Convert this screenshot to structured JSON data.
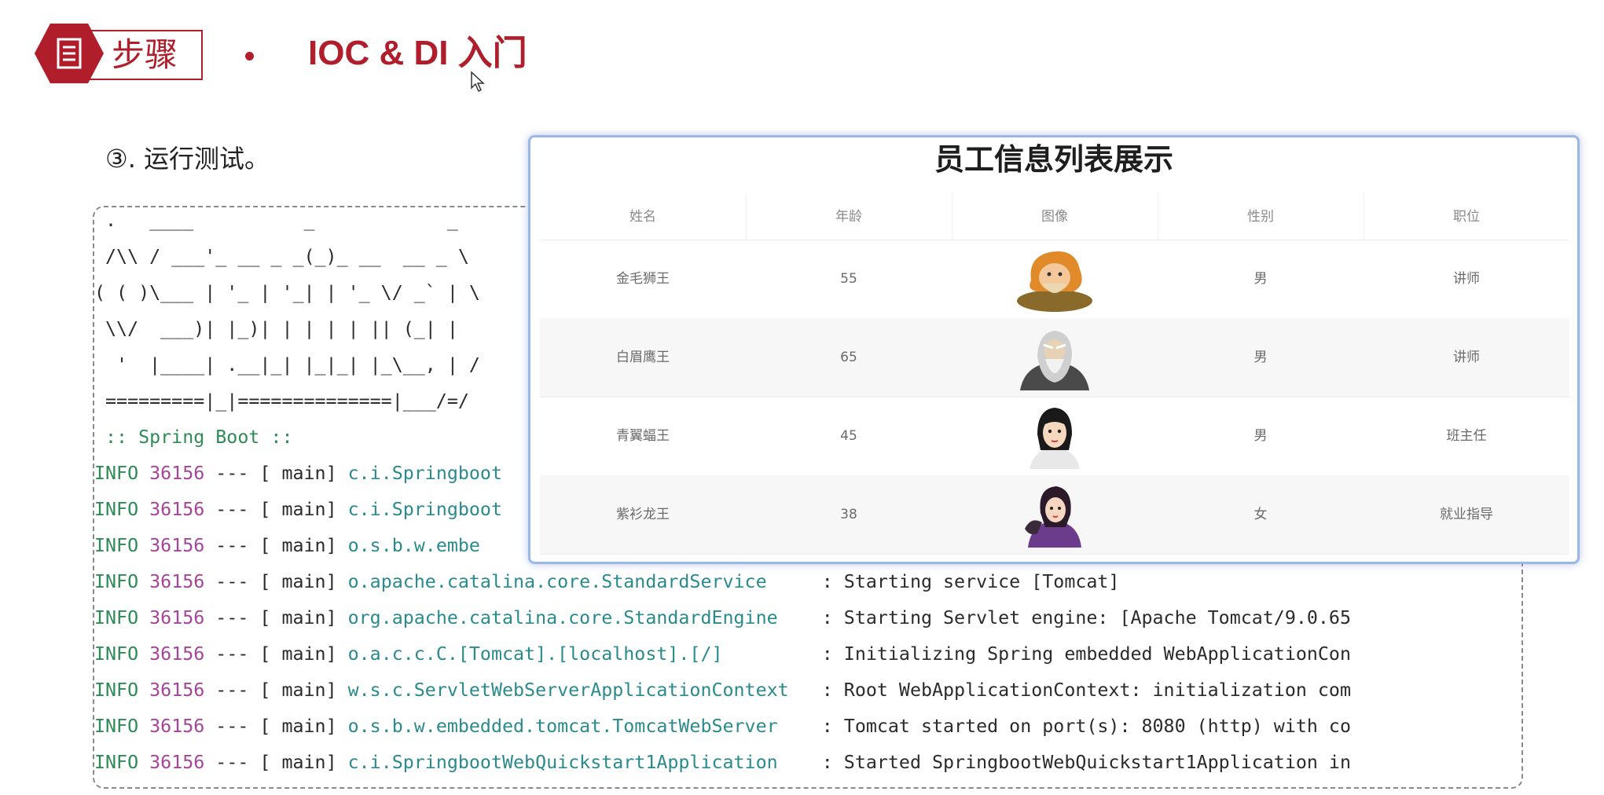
{
  "header": {
    "badge_label": "步骤",
    "title": "IOC & DI 入门"
  },
  "step": {
    "label": "③. 运行测试。"
  },
  "console": {
    "banner": [
      " .   ____          _            _",
      " /\\\\ / ___'_ __ _ _(_)_ __  __ _ \\",
      "( ( )\\___ | '_ | '_| | '_ \\/ _` | \\",
      " \\\\/  ___)| |_)| | | | | || (_| |",
      "  '  |____| .__|_| |_|_| |_\\__, | /",
      " =========|_|==============|___/=/"
    ],
    "spring_boot_label": " :: Spring Boot ::",
    "logs": [
      {
        "level": "INFO",
        "pid": "36156",
        "sep": " --- [ main] ",
        "logger": "c.i.Springboot",
        "msg": ""
      },
      {
        "level": "INFO",
        "pid": "36156",
        "sep": " --- [ main] ",
        "logger": "c.i.Springboot",
        "msg": ""
      },
      {
        "level": "INFO",
        "pid": "36156",
        "sep": " --- [ main] ",
        "logger": "o.s.b.w.embe",
        "msg": ""
      },
      {
        "level": "INFO",
        "pid": "36156",
        "sep": " --- [ main] ",
        "logger": "o.apache.catalina.core.StandardService    ",
        "msg": " : Starting service [Tomcat]"
      },
      {
        "level": "INFO",
        "pid": "36156",
        "sep": " --- [ main] ",
        "logger": "org.apache.catalina.core.StandardEngine   ",
        "msg": " : Starting Servlet engine: [Apache Tomcat/9.0.65"
      },
      {
        "level": "INFO",
        "pid": "36156",
        "sep": " --- [ main] ",
        "logger": "o.a.c.c.C.[Tomcat].[localhost].[/]        ",
        "msg": " : Initializing Spring embedded WebApplicationCon"
      },
      {
        "level": "INFO",
        "pid": "36156",
        "sep": " --- [ main] ",
        "logger": "w.s.c.ServletWebServerApplicationContext  ",
        "msg": " : Root WebApplicationContext: initialization com"
      },
      {
        "level": "INFO",
        "pid": "36156",
        "sep": " --- [ main] ",
        "logger": "o.s.b.w.embedded.tomcat.TomcatWebServer   ",
        "msg": " : Tomcat started on port(s): 8080 (http) with co"
      },
      {
        "level": "INFO",
        "pid": "36156",
        "sep": " --- [ main] ",
        "logger": "c.i.SpringbootWebQuickstart1Application   ",
        "msg": " : Started SpringbootWebQuickstart1Application in"
      }
    ]
  },
  "panel": {
    "title": "员工信息列表展示",
    "columns": [
      "姓名",
      "年龄",
      "图像",
      "性别",
      "职位"
    ],
    "rows": [
      {
        "name": "金毛狮王",
        "age": "55",
        "avatar": "golden-lion-king-avatar",
        "gender": "男",
        "job": "讲师"
      },
      {
        "name": "白眉鹰王",
        "age": "65",
        "avatar": "white-eyebrow-eagle-king-avatar",
        "gender": "男",
        "job": "讲师"
      },
      {
        "name": "青翼蝠王",
        "age": "45",
        "avatar": "green-wing-bat-king-avatar",
        "gender": "男",
        "job": "班主任"
      },
      {
        "name": "紫衫龙王",
        "age": "38",
        "avatar": "purple-robe-dragon-king-avatar",
        "gender": "女",
        "job": "就业指导"
      }
    ]
  },
  "colors": {
    "brand_red": "#b01e2b",
    "info_green": "#2e8b57",
    "pid_purple": "#a6449a",
    "logger_teal": "#2a8a8c",
    "panel_border": "#9bb7e8"
  }
}
